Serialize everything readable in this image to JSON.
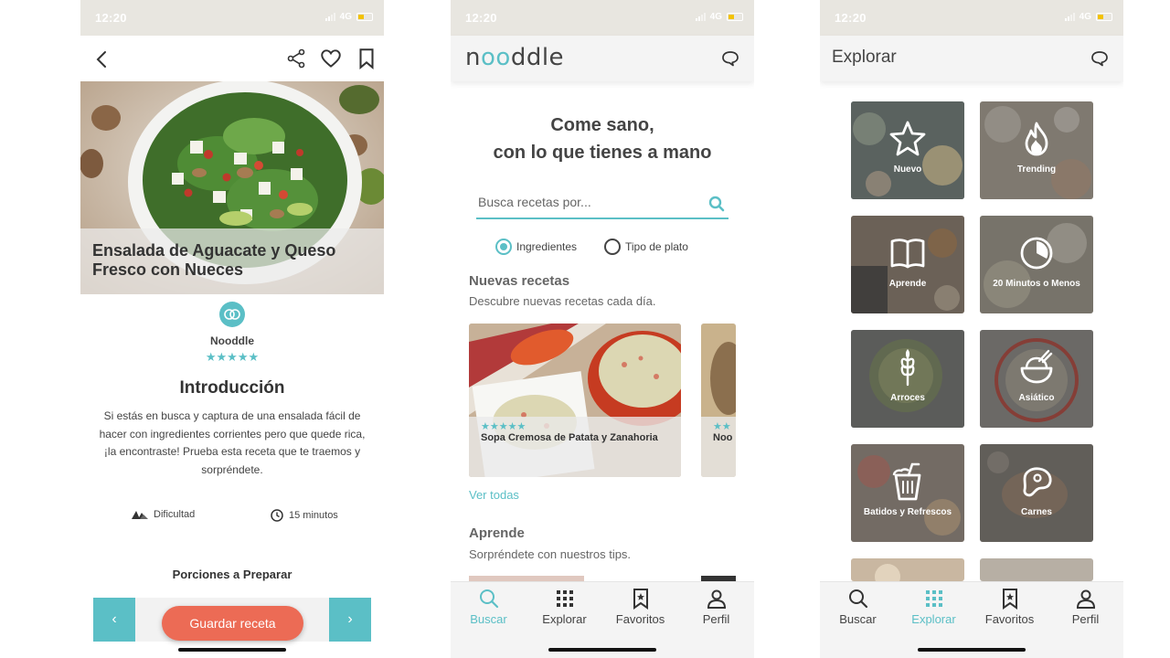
{
  "status": {
    "time": "12:20",
    "network": "4G"
  },
  "recipe": {
    "title": "Ensalada de Aguacate y Queso Fresco con Nueces",
    "author": "Nooddle",
    "rating_stars": "★★★★★",
    "intro_title": "Introducción",
    "intro_text": "Si estás en busca y captura de una ensalada fácil de hacer con ingredientes corrientes pero que quede rica, ¡la encontraste! Prueba esta receta que te traemos y sorpréndete.",
    "difficulty_label": "Dificultad",
    "time_label": "15 minutos",
    "portions_title": "Porciones a Preparar",
    "minus_label": "‹",
    "plus_label": "›",
    "save_button": "Guardar receta"
  },
  "home": {
    "logo_prefix": "n",
    "logo_oo": "oo",
    "logo_suffix": "ddle",
    "headline_line1": "Come sano,",
    "headline_line2": "con lo que tienes a mano",
    "search_placeholder": "Busca recetas por...",
    "radio_ingredients": "Ingredientes",
    "radio_dish": "Tipo de plato",
    "new_title": "Nuevas recetas",
    "new_subtitle": "Descubre nuevas recetas cada día.",
    "card1_stars": "★★★★★",
    "card1_title": "Sopa Cremosa de Patata y Zanahoria",
    "card2_stars": "★★",
    "card2_title": "Noo",
    "see_all": "Ver todas",
    "learn_title": "Aprende",
    "learn_subtitle": "Sorpréndete con nuestros tips."
  },
  "explore": {
    "title": "Explorar",
    "tiles": [
      {
        "label": "Nuevo",
        "icon": "star-icon"
      },
      {
        "label": "Trending",
        "icon": "flame-icon"
      },
      {
        "label": "Aprende",
        "icon": "book-icon"
      },
      {
        "label": "20 Minutos o Menos",
        "icon": "timer-icon"
      },
      {
        "label": "Arroces",
        "icon": "wheat-icon"
      },
      {
        "label": "Asiático",
        "icon": "rice-bowl-icon"
      },
      {
        "label": "Batidos y Refrescos",
        "icon": "drink-icon"
      },
      {
        "label": "Carnes",
        "icon": "steak-icon"
      }
    ]
  },
  "tabs": {
    "search": "Buscar",
    "explore": "Explorar",
    "favorites": "Favoritos",
    "profile": "Perfil"
  },
  "colors": {
    "accent": "#5bbfc6",
    "cta": "#ec6b55"
  }
}
